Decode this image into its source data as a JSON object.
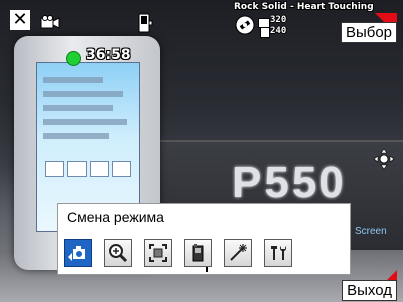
{
  "status_bar": {
    "timer": "36:58",
    "song_title": "Rock Solid - Heart Touching",
    "resolution_width": "320",
    "resolution_height": "240"
  },
  "softkeys": {
    "select_label": "Выбор",
    "exit_label": "Выход"
  },
  "menu": {
    "title": "Смена режима",
    "buttons": [
      {
        "icon": "camera-mode-icon",
        "active": true
      },
      {
        "icon": "zoom-icon",
        "active": false
      },
      {
        "icon": "frame-icon",
        "active": false
      },
      {
        "icon": "storage-icon",
        "active": false
      },
      {
        "icon": "effects-icon",
        "active": false
      },
      {
        "icon": "tools-icon",
        "active": false
      }
    ]
  },
  "background": {
    "model_text": "P550",
    "screen_text": "Screen"
  },
  "colors": {
    "record_indicator": "#1fcf34",
    "softkey_accent": "#e30b15",
    "active_button": "#1f66c4"
  }
}
